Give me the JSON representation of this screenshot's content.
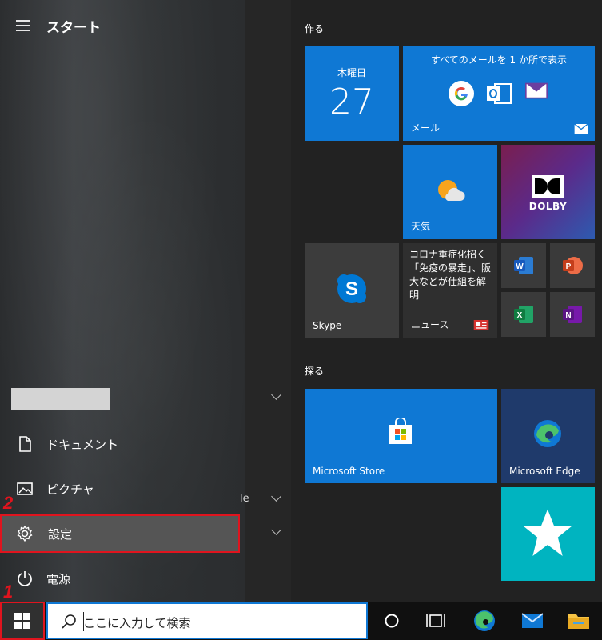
{
  "start_menu": {
    "title": "スタート",
    "places": [
      {
        "label": "ドキュメント",
        "icon": "document-icon"
      },
      {
        "label": "ピクチャ",
        "icon": "pictures-icon"
      },
      {
        "label": "設定",
        "icon": "gear-icon"
      },
      {
        "label": "電源",
        "icon": "power-icon"
      }
    ],
    "partial_text": "le"
  },
  "tile_groups": {
    "create": "作る",
    "explore": "探る"
  },
  "tiles": {
    "calendar": {
      "day": "木曜日",
      "date": "27"
    },
    "mail": {
      "headline": "すべてのメールを 1 か所で表示",
      "label": "メール"
    },
    "weather": {
      "label": "天気"
    },
    "dolby": {
      "label": "DOLBY"
    },
    "skype": {
      "label": "Skype"
    },
    "news": {
      "text": "コロナ重症化招く「免疫の暴走」、阪大などが仕組を解明",
      "label": "ニュース"
    },
    "store": {
      "label": "Microsoft Store"
    },
    "edge": {
      "label": "Microsoft Edge"
    }
  },
  "annotations": {
    "step1": "1",
    "step2": "2"
  },
  "taskbar": {
    "search_placeholder": "ここに入力して検索"
  },
  "colors": {
    "tile_blue": "#0f78d4",
    "highlight_red": "#e0141e",
    "teal": "#00b4c0"
  }
}
